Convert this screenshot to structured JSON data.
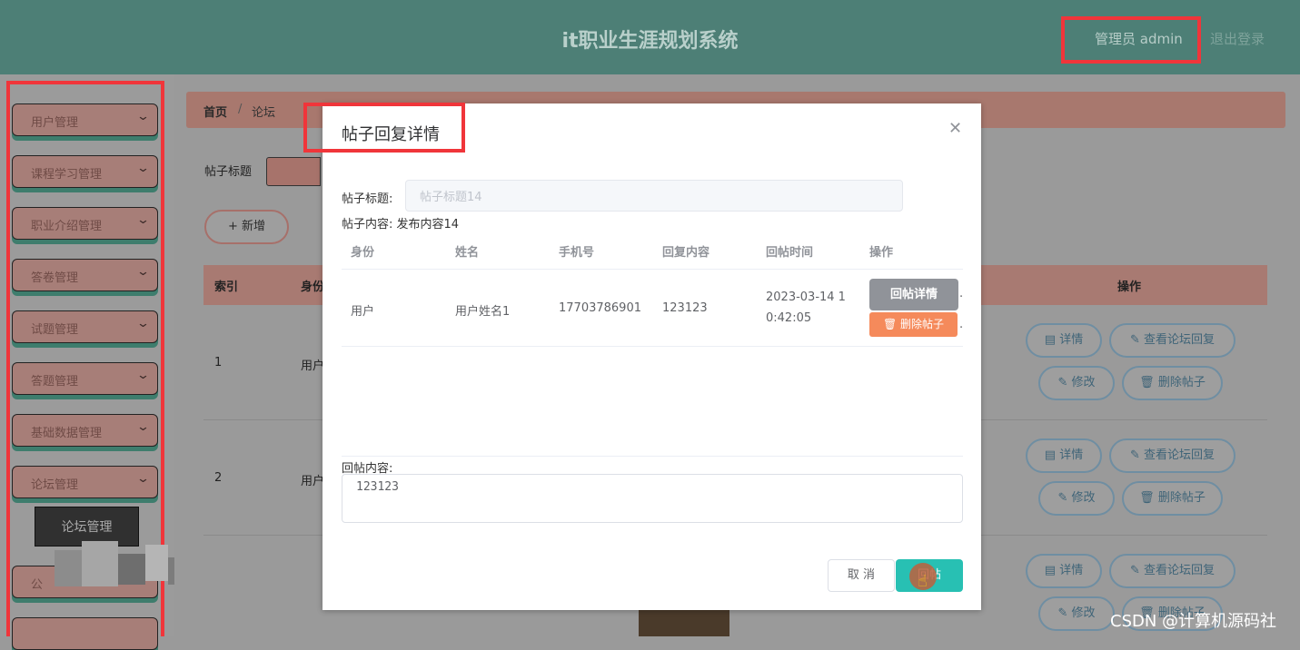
{
  "header": {
    "app_title": "it职业生涯规划系统",
    "user": "管理员 admin",
    "logout": "退出登录"
  },
  "sidebar": {
    "items": [
      {
        "label": "用户管理"
      },
      {
        "label": "课程学习管理"
      },
      {
        "label": "职业介绍管理"
      },
      {
        "label": "答卷管理"
      },
      {
        "label": "试题管理"
      },
      {
        "label": "答题管理"
      },
      {
        "label": "基础数据管理"
      },
      {
        "label": "论坛管理"
      },
      {
        "label": "公"
      }
    ],
    "active_sub": "论坛管理"
  },
  "breadcrumb": {
    "home": "首页",
    "sep": "/",
    "current": "论坛"
  },
  "search": {
    "label": "帖子标题"
  },
  "add_button": "+ 新增",
  "table": {
    "headers": [
      "索引",
      "身份",
      "操作"
    ],
    "rows": [
      {
        "index": "1",
        "identity": "用户"
      },
      {
        "index": "2",
        "identity": "用户"
      }
    ],
    "ops": {
      "detail": "详情",
      "view_reply": "查看论坛回复",
      "edit": "修改",
      "delete": "删除帖子"
    }
  },
  "dialog": {
    "title": "帖子回复详情",
    "post_title_label": "帖子标题:",
    "post_title_value": "帖子标题14",
    "post_content": "帖子内容: 发布内容14",
    "reply_table": {
      "headers": [
        "身份",
        "姓名",
        "手机号",
        "回复内容",
        "回帖时间",
        "操作"
      ],
      "row": {
        "identity": "用户",
        "name": "用户姓名1",
        "phone": "17703786901",
        "content": "123123",
        "time_line1": "2023-03-14 1",
        "time_line2": "0:42:05",
        "btn_detail": "回帖详情",
        "btn_delete": "删除帖子"
      }
    },
    "reply_label": "回帖内容:",
    "reply_value": "123123",
    "cancel": "取 消",
    "submit": "回帖"
  },
  "watermark": "CSDN @计算机源码社"
}
